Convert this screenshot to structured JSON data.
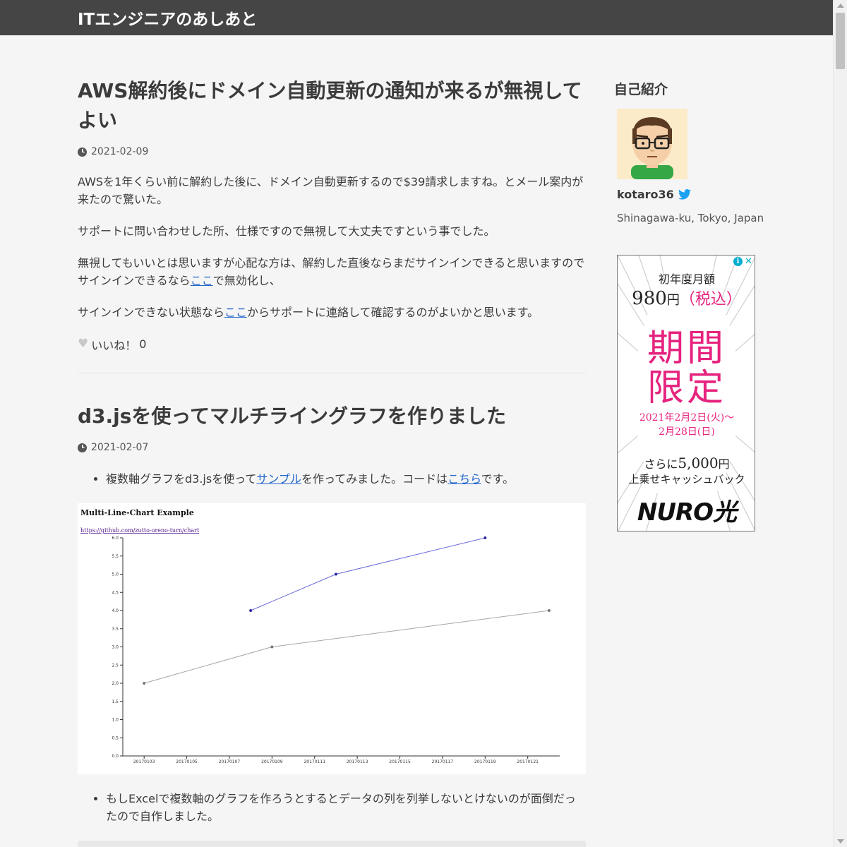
{
  "site": {
    "title": "ITエンジニアのあしあと"
  },
  "posts": [
    {
      "title": "AWS解約後にドメイン自動更新の通知が来るが無視してよい",
      "date": "2021-02-09",
      "p1": "AWSを1年くらい前に解約した後に、ドメイン自動更新するので$39請求しますね。とメール案内が来たので驚いた。",
      "p2": "サポートに問い合わせした所、仕様ですので無視して大丈夫ですという事でした。",
      "p3_before": "無視してもいいとは思いますが心配な方は、解約した直後ならまだサインインできると思いますのでサインインできるなら",
      "p3_link": "ここ",
      "p3_after": "で無効化し、",
      "p4_before": "サインインできない状態なら",
      "p4_link": "ここ",
      "p4_after": "からサポートに連絡して確認するのがよいかと思います。",
      "like_label": "いいね！",
      "like_count": "0"
    },
    {
      "title": "d3.jsを使ってマルチライングラフを作りました",
      "date": "2021-02-07",
      "li1_before": "複数軸グラフをd3.jsを使って",
      "li1_link1": "サンプル",
      "li1_middle": "を作ってみました。コードは",
      "li1_link2": "こちら",
      "li1_after": "です。",
      "li2": "もしExcelで複数軸のグラフを作ろうとするとデータの列を列挙しないとけないのが面倒だったので自作しました。"
    }
  ],
  "chart_data": {
    "type": "line",
    "title": "Multi-Line-Chart Example",
    "link": "https://github.com/zutto-oreno-turn/chart",
    "x_ticks": [
      "20170103",
      "20170105",
      "20170107",
      "20170109",
      "20170111",
      "20170113",
      "20170115",
      "20170117",
      "20170119",
      "20170121"
    ],
    "y_ticks": [
      "0.0",
      "0.5",
      "1.0",
      "1.5",
      "2.0",
      "2.5",
      "3.0",
      "3.5",
      "4.0",
      "4.5",
      "5.0",
      "5.5",
      "6.0"
    ],
    "ylim": [
      0,
      6
    ],
    "series": [
      {
        "color": "#6a6ad8",
        "point_color": "#2a2aa0",
        "x": [
          "20170108",
          "20170112",
          "20170119"
        ],
        "y": [
          4,
          5,
          6
        ]
      },
      {
        "color": "#a6a6a6",
        "point_color": "#777777",
        "x": [
          "20170103",
          "20170109",
          "20170122"
        ],
        "y": [
          2,
          3,
          4
        ]
      }
    ]
  },
  "sidebar": {
    "title": "自己紹介",
    "name": "kotaro36",
    "location": "Shinagawa-ku, Tokyo, Japan"
  },
  "ad": {
    "line1": "初年度月額",
    "line2_num": "980",
    "line2_unit": "円",
    "line2_tax": "（税込）",
    "line3a": "期間",
    "line3b": "限定",
    "line4a": "2021年2月2日(火)〜",
    "line4b": "2月28日(日)",
    "line5_pre": "さらに",
    "line5_num": "5,000",
    "line5_unit": "円",
    "line6": "上乗せキャッシュバック",
    "logo": "NURO光",
    "colors": {
      "pink": "#e6237e",
      "info": "#00aecd"
    }
  }
}
